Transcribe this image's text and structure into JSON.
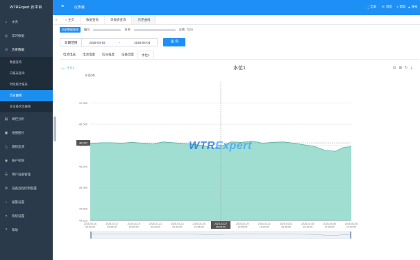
{
  "app": {
    "title": "WTRExpert 云平台"
  },
  "sidebar": {
    "items": [
      {
        "label": "水务",
        "icon": "home-icon"
      },
      {
        "label": "实时数据",
        "icon": "monitor-icon"
      },
      {
        "label": "历史数据",
        "icon": "history-icon"
      },
      {
        "label": "阀控分析",
        "icon": "analysis-icon"
      },
      {
        "label": "地图图片",
        "icon": "map-icon"
      },
      {
        "label": "漏损监测",
        "icon": "alert-icon"
      },
      {
        "label": "帐户权限",
        "icon": "account-icon"
      },
      {
        "label": "用户设备管理",
        "icon": "device-icon"
      },
      {
        "label": "设备远程控制配置",
        "icon": "remote-icon"
      },
      {
        "label": "报警设置",
        "icon": "bell-icon"
      },
      {
        "label": "系统设置",
        "icon": "settings-icon"
      },
      {
        "label": "帮助",
        "icon": "help-icon"
      }
    ],
    "sub_items": [
      "数据查询",
      "日报表查询",
      "时段统计报表",
      "历史曲线",
      "多设备水位曲线"
    ]
  },
  "topbar": {
    "crumb": "仪表板",
    "tools": [
      "全屏",
      "消息",
      "帮助",
      "账号"
    ]
  },
  "tabs": [
    "主页",
    "数据查询",
    "日报表查询",
    "历史曲线"
  ],
  "info": {
    "tag": "历史数据查询",
    "label1": "编号",
    "label2": "名称",
    "total": "总数: 7104"
  },
  "query": {
    "label": "日期范围",
    "start": "2025-03-16",
    "sep": "-",
    "end": "2025-04-03",
    "button": "查 询"
  },
  "subtabs": [
    "电池电压",
    "电池电量",
    "信号强度",
    "设备温度",
    "水位1"
  ],
  "chart": {
    "legend": "水位1",
    "title": "水位1",
    "unit_label": "水位(M)",
    "tooltip_value": "46.057",
    "tooltip_time": "2025-03-27\n05:25:00",
    "watermark_1": "WTR",
    "watermark_2": "Expert"
  },
  "chart_data": {
    "type": "area",
    "title": "水位1",
    "ylabel": "水位(M)",
    "ylim": [
      44.223,
      47.5
    ],
    "yticks": [
      44.223,
      44.5,
      45.0,
      45.5,
      46.0,
      46.5,
      47.0
    ],
    "xticks": [
      "2025-03-16 00:00:00",
      "2025-03-17 23:25:00",
      "2025-03-19 22:50:00",
      "2025-03-21 22:15:00",
      "2025-03-23 21:40:00",
      "2025-03-25 21:05:00",
      "2025-03-27 05:25:00",
      "2025-03-29 19:55:00",
      "2025-03-31 19:20:00",
      "2025-04-02 18:45:00",
      "2025-04-04 18:10:00",
      "2025-04-06 17:35:00",
      "2025-04-08 17:00:00"
    ],
    "series": [
      {
        "name": "水位1",
        "color": "#8fd8c9",
        "x": [
          0,
          0.04,
          0.08,
          0.12,
          0.16,
          0.2,
          0.24,
          0.28,
          0.32,
          0.36,
          0.4,
          0.44,
          0.47,
          0.5,
          0.54,
          0.58,
          0.62,
          0.66,
          0.7,
          0.74,
          0.78,
          0.82,
          0.86,
          0.9,
          0.94,
          0.97,
          1.0
        ],
        "values": [
          46.04,
          46.06,
          46.06,
          46.05,
          46.07,
          46.05,
          46.03,
          46.08,
          46.06,
          46.04,
          46.02,
          45.98,
          45.93,
          45.97,
          46.08,
          46.07,
          46.1,
          46.05,
          46.07,
          46.08,
          46.05,
          46.01,
          45.97,
          45.88,
          45.86,
          45.95,
          45.97
        ]
      }
    ],
    "grid": true,
    "legend_position": "top-left"
  },
  "colors": {
    "accent": "#1e8ff5",
    "sidebar": "#2b3a4a",
    "area": "#8fd8c9"
  }
}
